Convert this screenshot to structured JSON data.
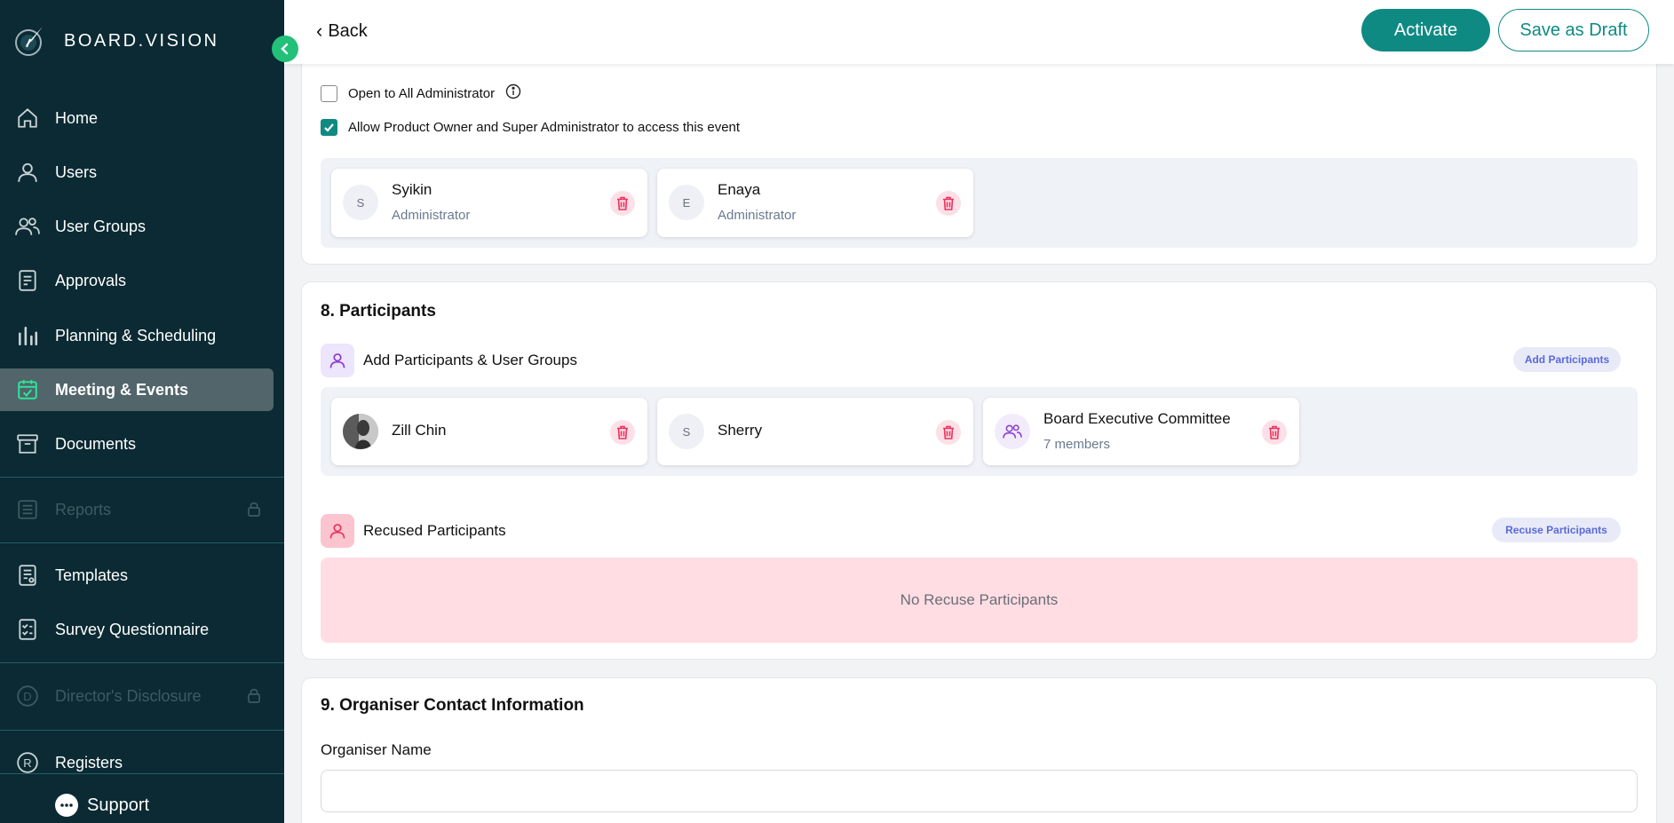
{
  "brand": {
    "name": "BOARD.VISION"
  },
  "sidebar": {
    "items": [
      {
        "label": "Home",
        "icon": "home-icon"
      },
      {
        "label": "Users",
        "icon": "user-icon"
      },
      {
        "label": "User Groups",
        "icon": "users-icon"
      },
      {
        "label": "Approvals",
        "icon": "approvals-icon"
      },
      {
        "label": "Planning & Scheduling",
        "icon": "chart-bars-icon"
      },
      {
        "label": "Meeting & Events",
        "icon": "calendar-check-icon",
        "active": true
      },
      {
        "label": "Documents",
        "icon": "archive-icon"
      },
      {
        "label": "Reports",
        "icon": "list-icon",
        "disabled": true
      },
      {
        "label": "Templates",
        "icon": "template-icon"
      },
      {
        "label": "Survey Questionnaire",
        "icon": "survey-icon"
      },
      {
        "label": "Director's Disclosure",
        "icon": "d-circle-icon",
        "disabled": true
      },
      {
        "label": "Registers",
        "icon": "r-circle-icon"
      }
    ],
    "support_label": "Support"
  },
  "header": {
    "back_label": "Back",
    "activate_label": "Activate",
    "draft_label": "Save as Draft"
  },
  "access": {
    "open_all_label": "Open to All Administrator",
    "open_all_checked": false,
    "allow_owner_label": "Allow Product Owner and Super Administrator to access this event",
    "allow_owner_checked": true,
    "admins": [
      {
        "initial": "S",
        "name": "Syikin",
        "role": "Administrator"
      },
      {
        "initial": "E",
        "name": "Enaya",
        "role": "Administrator"
      }
    ]
  },
  "participants": {
    "title": "8. Participants",
    "add_label": "Add Participants & User Groups",
    "add_button": "Add Participants",
    "list": [
      {
        "name": "Zill Chin",
        "type": "photo"
      },
      {
        "name": "Sherry",
        "initial": "S"
      },
      {
        "name": "Board Executive Committee",
        "members": "7 members",
        "type": "group"
      }
    ],
    "recused_label": "Recused Participants",
    "recuse_button": "Recuse Participants",
    "recused_empty": "No Recuse Participants"
  },
  "organiser": {
    "title": "9. Organiser Contact Information",
    "name_label": "Organiser Name",
    "name_value": ""
  },
  "colors": {
    "sidebar_bg": "#0b2a33",
    "accent": "#0f8a83",
    "collapse": "#23c07a",
    "danger": "#e8335e"
  }
}
